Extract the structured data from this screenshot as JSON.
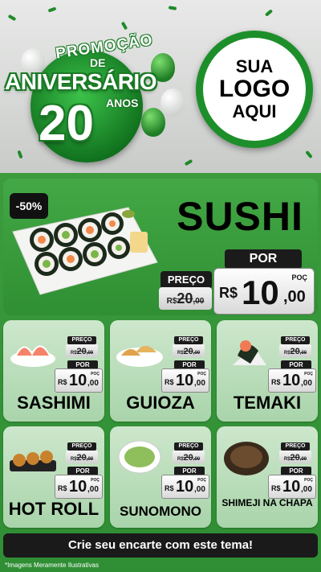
{
  "header": {
    "badge": {
      "promo": "PROMOÇÃO",
      "de": "DE",
      "aniversario": "ANIVERSÁRIO",
      "number": "20",
      "anos": "ANOS"
    },
    "logo": {
      "line1": "SUA",
      "line2": "LOGO",
      "line3": "AQUI"
    }
  },
  "hero": {
    "discount": "-50%",
    "title": "SUSHI",
    "preco_label": "PREÇO",
    "old_price": {
      "currency": "R$",
      "integer": "20",
      "cents": ",00"
    },
    "por_label": "POR",
    "new_price": {
      "currency": "R$",
      "integer": "10",
      "cents": ",00",
      "unit": "POÇ"
    }
  },
  "products": [
    {
      "name": "SASHIMI",
      "preco_label": "PREÇO",
      "old_currency": "R$",
      "old_integer": "20",
      "old_cents": ",00",
      "por_label": "POR",
      "new_currency": "R$",
      "new_integer": "10",
      "new_cents": ",00",
      "unit": "POÇ"
    },
    {
      "name": "GUIOZA",
      "preco_label": "PREÇO",
      "old_currency": "R$",
      "old_integer": "20",
      "old_cents": ",00",
      "por_label": "POR",
      "new_currency": "R$",
      "new_integer": "10",
      "new_cents": ",00",
      "unit": "POÇ"
    },
    {
      "name": "TEMAKI",
      "preco_label": "PREÇO",
      "old_currency": "R$",
      "old_integer": "20",
      "old_cents": ",00",
      "por_label": "POR",
      "new_currency": "R$",
      "new_integer": "10",
      "new_cents": ",00",
      "unit": "POÇ"
    },
    {
      "name": "HOT ROLL",
      "preco_label": "PREÇO",
      "old_currency": "R$",
      "old_integer": "20",
      "old_cents": ",00",
      "por_label": "POR",
      "new_currency": "R$",
      "new_integer": "10",
      "new_cents": ",00",
      "unit": "POÇ"
    },
    {
      "name": "SUNOMONO",
      "preco_label": "PREÇO",
      "old_currency": "R$",
      "old_integer": "20",
      "old_cents": ",00",
      "por_label": "POR",
      "new_currency": "R$",
      "new_integer": "10",
      "new_cents": ",00",
      "unit": "POÇ"
    },
    {
      "name": "SHIMEJI NA CHAPA",
      "preco_label": "PREÇO",
      "old_currency": "R$",
      "old_integer": "20",
      "old_cents": ",00",
      "por_label": "POR",
      "new_currency": "R$",
      "new_integer": "10",
      "new_cents": ",00",
      "unit": "POÇ"
    }
  ],
  "cta": "Crie seu encarte com este tema!",
  "disclaimer": "*Imagens Meramente Ilustrativas",
  "colors": {
    "primary_green": "#2f8e34",
    "dark": "#1b1b1b",
    "card_bg": "#bfe0bf"
  }
}
